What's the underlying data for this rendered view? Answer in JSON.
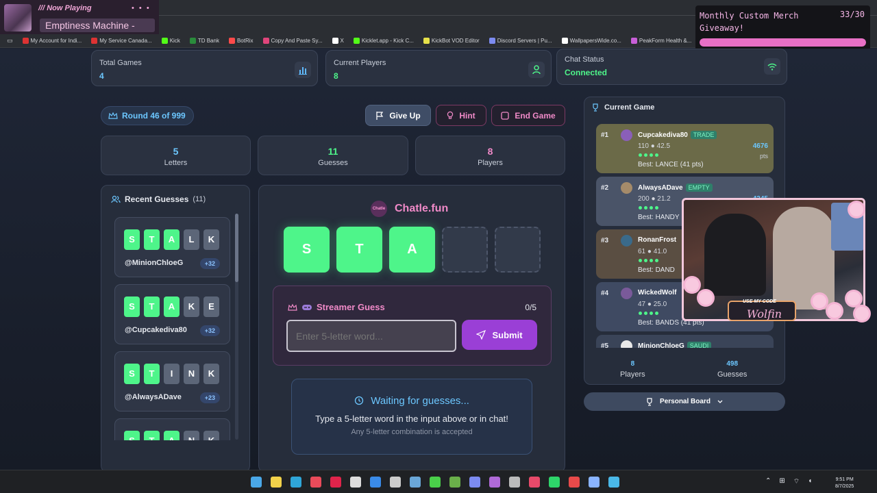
{
  "overlay": {
    "now_playing_label": "/// Now Playing",
    "now_playing_dots": "• • •",
    "now_playing_title": "Emptiness Machine -",
    "merch_title": "Monthly Custom Merch Giveaway!",
    "merch_count": "33/30",
    "merch_progress": 1.0,
    "webcam_code_label": "USE MY CODE",
    "webcam_code_name": "Wolfin"
  },
  "bookmarks": [
    {
      "label": "My Account for Indi...",
      "icon": "maple-leaf-icon",
      "color": "#d33"
    },
    {
      "label": "My Service Canada...",
      "icon": "maple-leaf-icon",
      "color": "#d33"
    },
    {
      "label": "Kick",
      "icon": "kick-icon",
      "color": "#53fc18"
    },
    {
      "label": "TD Bank",
      "icon": "td-icon",
      "color": "#2a8c3c"
    },
    {
      "label": "BotRix",
      "icon": "botrix-icon",
      "color": "#ff4a4a"
    },
    {
      "label": "Copy And Paste Sy...",
      "icon": "copy-icon",
      "color": "#e0457b"
    },
    {
      "label": "X",
      "icon": "x-icon",
      "color": "#ffffff"
    },
    {
      "label": "Kicklet.app - Kick C...",
      "icon": "kicklet-icon",
      "color": "#53fc18"
    },
    {
      "label": "KickBot VOD Editor",
      "icon": "kickbot-icon",
      "color": "#e6e14a"
    },
    {
      "label": "Discord Servers | Pu...",
      "icon": "discord-icon",
      "color": "#7c8bf0"
    },
    {
      "label": "WallpapersWide.co...",
      "icon": "wallpaper-icon",
      "color": "#ffffff"
    },
    {
      "label": "PeakForm Health &...",
      "icon": "peakform-icon",
      "color": "#c85fd8"
    }
  ],
  "stats": {
    "total_games_label": "Total Games",
    "total_games_value": "4",
    "current_players_label": "Current Players",
    "current_players_value": "8",
    "chat_status_label": "Chat Status",
    "chat_status_value": "Connected"
  },
  "round": "Round 46 of 999",
  "actions": {
    "give_up": "Give Up",
    "hint": "Hint",
    "end_game": "End Game"
  },
  "info": [
    {
      "value": "5",
      "label": "Letters",
      "color": "#6cc7ff"
    },
    {
      "value": "11",
      "label": "Guesses",
      "color": "#4ef58a"
    },
    {
      "value": "8",
      "label": "Players",
      "color": "#f08ac8"
    }
  ],
  "recent": {
    "title": "Recent Guesses",
    "count": "(11)",
    "guesses": [
      {
        "letters": [
          "S",
          "T",
          "A",
          "L",
          "K"
        ],
        "states": [
          "c",
          "c",
          "c",
          "w",
          "w"
        ],
        "user": "@MinionChloeG",
        "points": "+32"
      },
      {
        "letters": [
          "S",
          "T",
          "A",
          "K",
          "E"
        ],
        "states": [
          "c",
          "c",
          "c",
          "w",
          "w"
        ],
        "user": "@Cupcakediva80",
        "points": "+32"
      },
      {
        "letters": [
          "S",
          "T",
          "I",
          "N",
          "K"
        ],
        "states": [
          "c",
          "c",
          "w",
          "w",
          "w"
        ],
        "user": "@AlwaysADave",
        "points": "+23"
      },
      {
        "letters": [
          "S",
          "T",
          "A",
          "N",
          "K"
        ],
        "states": [
          "c",
          "c",
          "c",
          "w",
          "w"
        ],
        "user": "",
        "points": ""
      }
    ]
  },
  "game": {
    "brand_logo": "Chatle",
    "brand_name": "Chatle.fun",
    "board": [
      "S",
      "T",
      "A",
      "",
      ""
    ],
    "streamer_guess_title": "Streamer Guess",
    "streamer_guess_count": "0/5",
    "input_placeholder": "Enter 5-letter word...",
    "submit": "Submit",
    "waiting_title": "Waiting for guesses...",
    "waiting_desc": "Type a 5-letter word in the input above or in chat!",
    "waiting_sub": "Any 5-letter combination is accepted"
  },
  "current_game": {
    "title": "Current Game",
    "players": [
      {
        "rank": "#1",
        "name": "Cupcakediva80",
        "tag": "TRADE",
        "stats": "110 ● 42.5",
        "best": "Best: LANCE (41 pts)",
        "score": "4676",
        "unit": "pts",
        "bg": "#6b6a48",
        "av": "#8a5fb8"
      },
      {
        "rank": "#2",
        "name": "AlwaysADave",
        "tag": "EMPTY",
        "stats": "200 ● 21.2",
        "best": "Best: HANDY",
        "score": "4245",
        "unit": "",
        "bg": "#4a5468",
        "av": "#a58b6a"
      },
      {
        "rank": "#3",
        "name": "RonanFrost",
        "tag": "",
        "stats": "61 ● 41.0",
        "best": "Best: DAND",
        "score": "",
        "unit": "",
        "bg": "#5a4e42",
        "av": "#3a6a8a"
      },
      {
        "rank": "#4",
        "name": "WickedWolf",
        "tag": "",
        "stats": "47 ● 25.0",
        "best": "Best: BANDS (41 pts)",
        "score": "",
        "unit": "",
        "bg": "#3f4a62",
        "av": "#7a5a9a"
      },
      {
        "rank": "#5",
        "name": "MinionChloeG",
        "tag": "SAUDI",
        "stats": "",
        "best": "",
        "score": "",
        "unit": "",
        "bg": "#3a4458",
        "av": "#e8e8e8"
      }
    ],
    "footer_players_value": "8",
    "footer_players_label": "Players",
    "footer_guesses_value": "498",
    "footer_guesses_label": "Guesses",
    "personal_board": "Personal Board"
  },
  "taskbar": {
    "time": "9:51 PM",
    "date": "8/7/2025"
  }
}
